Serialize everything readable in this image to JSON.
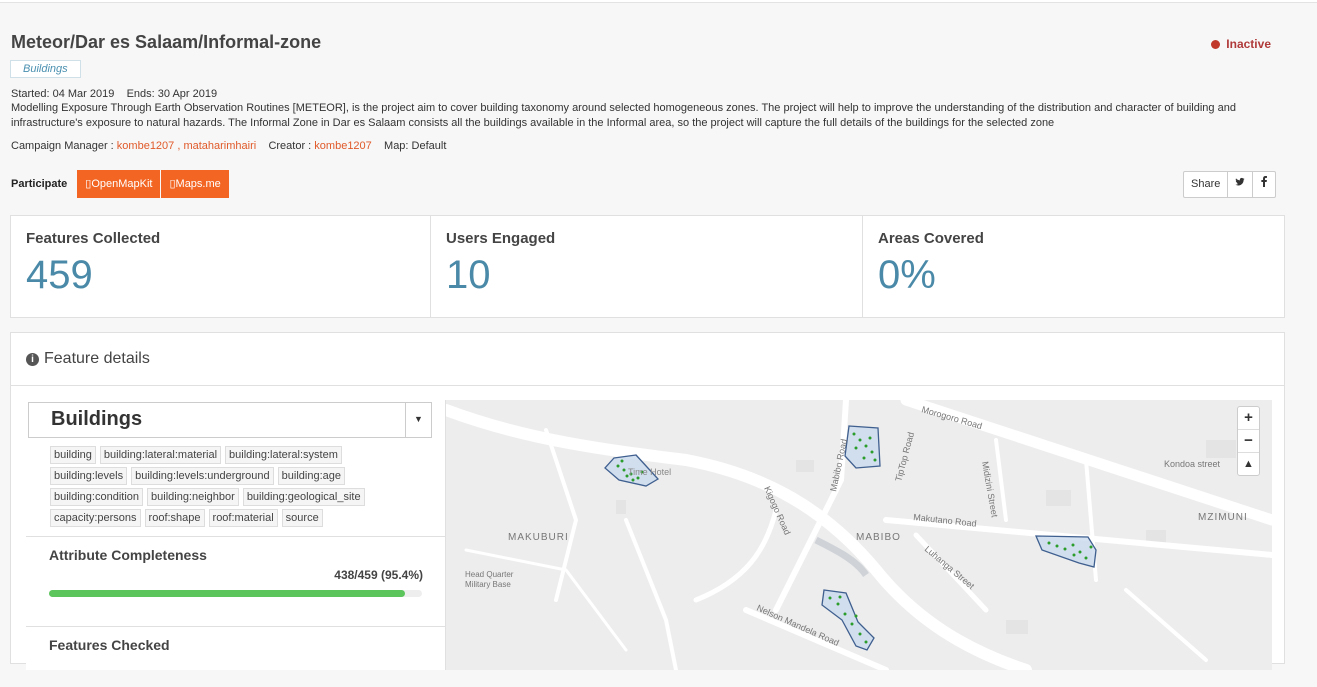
{
  "header": {
    "title": "Meteor/Dar es Salaam/Informal-zone",
    "status": "Inactive",
    "tag": "Buildings",
    "started": "Started: 04 Mar 2019",
    "ends": "Ends: 30 Apr 2019",
    "description": "Modelling Exposure Through Earth Observation Routines [METEOR], is the project aim to cover building taxonomy around selected homogeneous zones. The project will help to improve the understanding of the distribution and character of building and infrastructure's exposure to natural hazards. The Informal Zone in Dar es Salaam consists all the buildings available in the Informal area, so the project will capture the full details of the buildings for the selected zone",
    "campaign_manager_label": "Campaign Manager :",
    "campaign_managers": "kombe1207 , mataharimhairi",
    "creator_label": "Creator :",
    "creator": "kombe1207",
    "map_label": "Map: Default"
  },
  "participate": {
    "label": "Participate",
    "openmapkit": "OpenMapKit",
    "mapsme": "Maps.me"
  },
  "share": {
    "label": "Share",
    "twitter_icon": "twitter-icon",
    "facebook_icon": "facebook-icon"
  },
  "stats": {
    "features_label": "Features Collected",
    "features_value": "459",
    "users_label": "Users Engaged",
    "users_value": "10",
    "areas_label": "Areas Covered",
    "areas_value": "0%"
  },
  "feature_details": {
    "title": "Feature details",
    "selected_type": "Buildings",
    "chips": [
      "building",
      "building:lateral:material",
      "building:lateral:system",
      "building:levels",
      "building:levels:underground",
      "building:age",
      "building:condition",
      "building:neighbor",
      "building:geological_site",
      "capacity:persons",
      "roof:shape",
      "roof:material",
      "source"
    ],
    "completeness_title": "Attribute Completeness",
    "completeness_ratio": "438/459 (95.4%)",
    "completeness_fraction": 0.954,
    "checked_title": "Features Checked"
  },
  "map": {
    "labels": [
      "Morogoro Road",
      "Time Hotel",
      "TipTop Road",
      "Mabibo Road",
      "Kigogo Road",
      "Midizini Street",
      "Kondoa street",
      "MZIMUNI",
      "Makutano Road",
      "MAKUBURI",
      "MABIBO",
      "Luhanga Street",
      "Head Quarter",
      "Military Base",
      "Nelson Mandela Road"
    ],
    "zoom_in": "+",
    "zoom_out": "−",
    "reset": "▲"
  }
}
